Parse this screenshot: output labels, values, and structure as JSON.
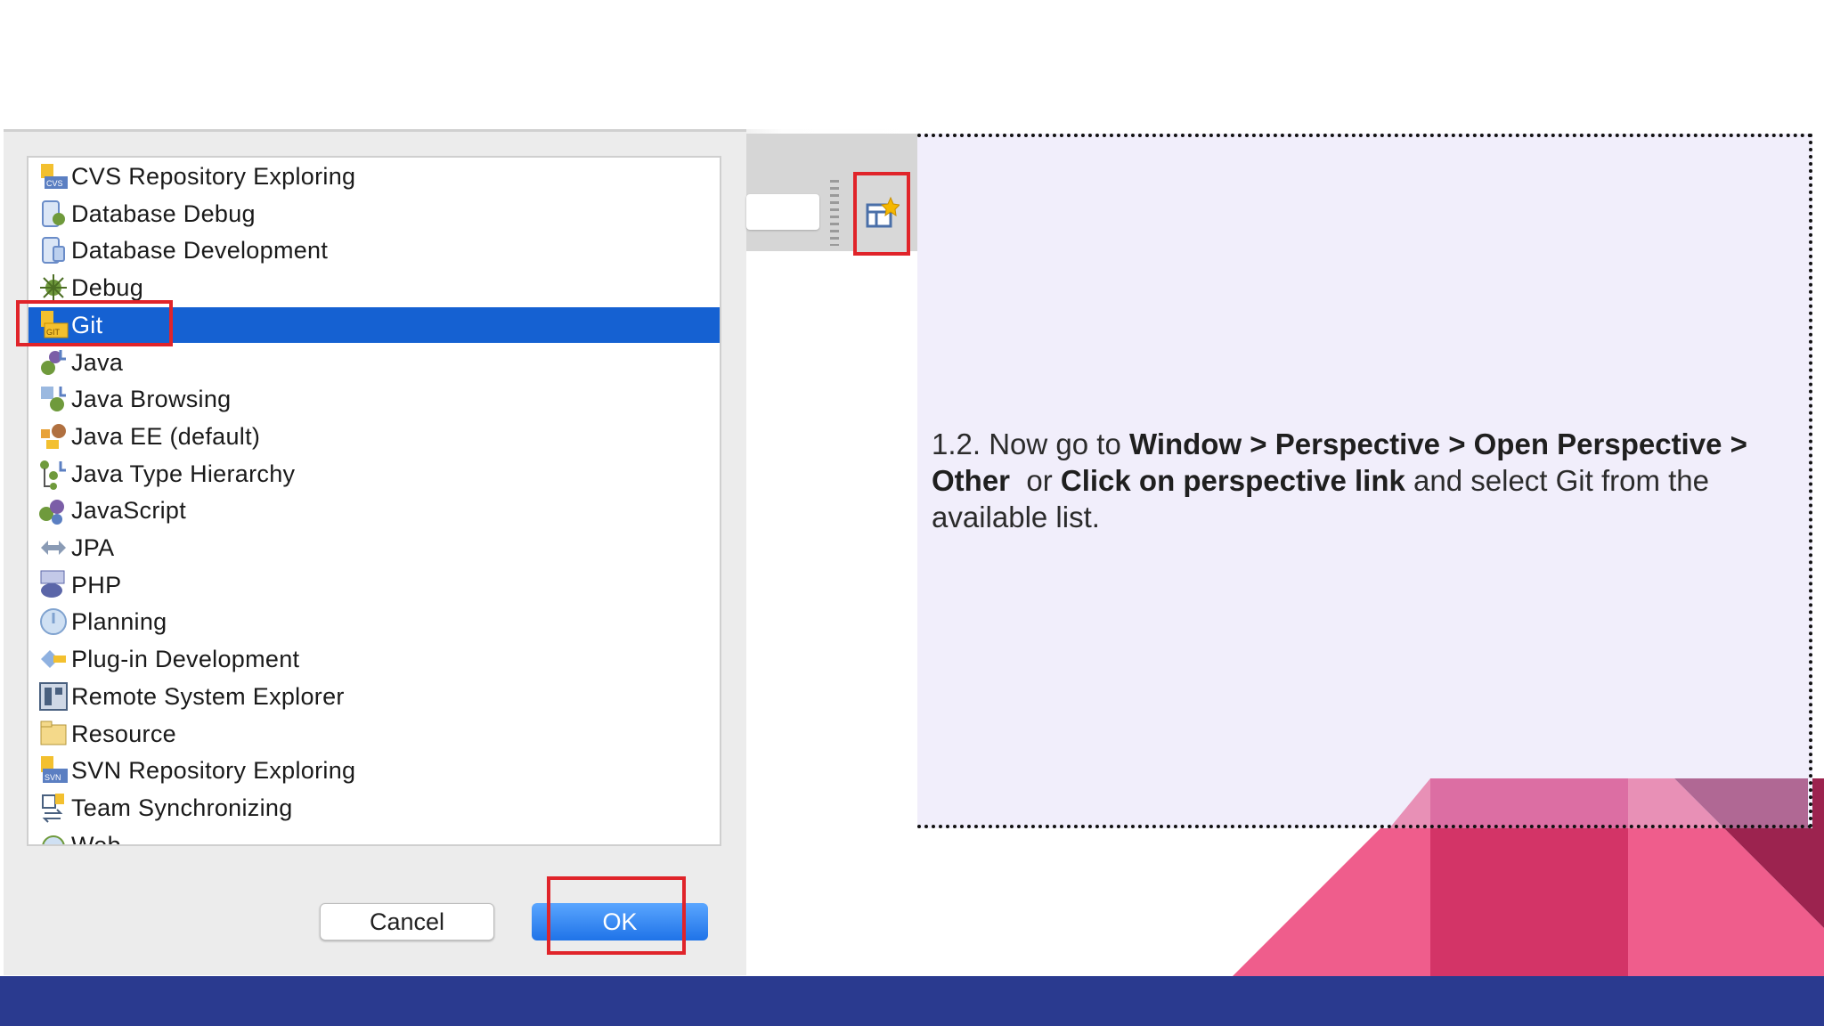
{
  "dialog": {
    "perspectives": [
      {
        "label": "CVS Repository Exploring",
        "icon": "cvs-repository-icon"
      },
      {
        "label": "Database Debug",
        "icon": "database-debug-icon"
      },
      {
        "label": "Database Development",
        "icon": "database-development-icon"
      },
      {
        "label": "Debug",
        "icon": "debug-bug-icon"
      },
      {
        "label": "Git",
        "icon": "git-icon",
        "selected": true
      },
      {
        "label": "Java",
        "icon": "java-icon"
      },
      {
        "label": "Java Browsing",
        "icon": "java-browsing-icon"
      },
      {
        "label": "Java EE (default)",
        "icon": "java-ee-icon"
      },
      {
        "label": "Java Type Hierarchy",
        "icon": "java-type-hierarchy-icon"
      },
      {
        "label": "JavaScript",
        "icon": "javascript-icon"
      },
      {
        "label": "JPA",
        "icon": "jpa-icon"
      },
      {
        "label": "PHP",
        "icon": "php-icon"
      },
      {
        "label": "Planning",
        "icon": "planning-icon"
      },
      {
        "label": "Plug-in Development",
        "icon": "plugin-development-icon"
      },
      {
        "label": "Remote System Explorer",
        "icon": "remote-system-explorer-icon"
      },
      {
        "label": "Resource",
        "icon": "resource-folder-icon"
      },
      {
        "label": "SVN Repository Exploring",
        "icon": "svn-repository-icon"
      },
      {
        "label": "Team Synchronizing",
        "icon": "team-synchronizing-icon"
      },
      {
        "label": "Web",
        "icon": "web-icon"
      }
    ],
    "cancel_label": "Cancel",
    "ok_label": "OK",
    "highlight_color": "#e0242a",
    "selection_color": "#1561d2"
  },
  "toolbar": {
    "perspective_button_icon": "open-perspective-icon"
  },
  "instruction": {
    "step": "1.2. Now go to ",
    "menu_path": "Window > Perspective > Open Perspective > Other",
    "or_text": "  or ",
    "link_text": "Click on perspective link",
    "rest_text": " and select Git from the available list."
  },
  "theme": {
    "panel_bg": "#f1eefb",
    "footer_color": "#2a3a8f",
    "accent_pink": "#ef5d8c",
    "accent_crimson": "#d33467",
    "accent_maroon": "#9c234f"
  }
}
